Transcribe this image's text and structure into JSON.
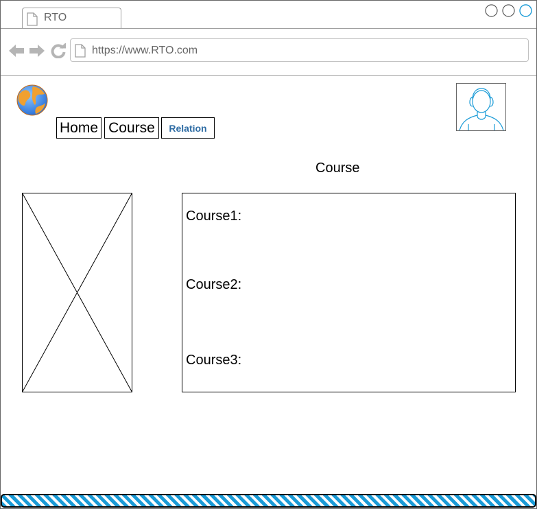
{
  "browser": {
    "tab_title": "RTO",
    "url": "https://www.RTO.com",
    "window_controls": [
      "circle-icon",
      "circle-icon",
      "circle-icon"
    ],
    "nav_icons": [
      "back-arrow-icon",
      "forward-arrow-icon",
      "reload-icon"
    ]
  },
  "header": {
    "logo_icon": "globe-icon",
    "avatar_icon": "user-avatar-icon"
  },
  "menu": {
    "items": [
      {
        "label": "Home"
      },
      {
        "label": "Course"
      },
      {
        "label": "Relation"
      }
    ],
    "active_color": "#2e6ca4"
  },
  "main": {
    "title": "Course",
    "image_icon": "image-placeholder-icon",
    "courses": [
      {
        "label": "Course1:"
      },
      {
        "label": "Course2:"
      },
      {
        "label": "Course3:"
      }
    ]
  },
  "colors": {
    "accent": "#1a9bd7",
    "chrome_gray": "#a0a0a0",
    "text_gray": "#666666"
  }
}
